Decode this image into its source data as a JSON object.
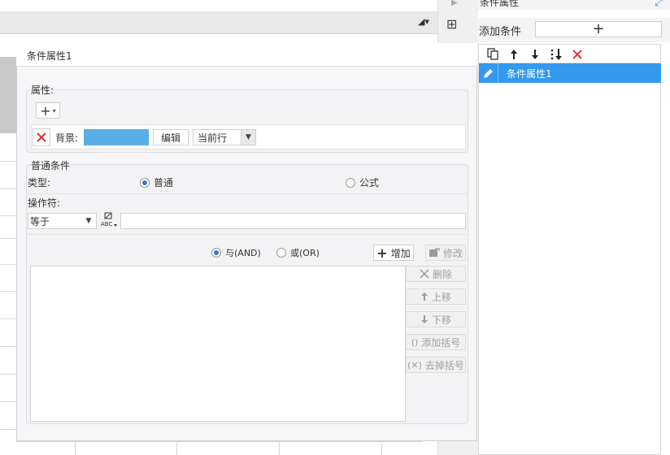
{
  "right_panel": {
    "title": "条件属性",
    "add_condition_label": "添加条件",
    "add_button_glyph": "+",
    "toolbar_icons": [
      "copy-icon",
      "arrow-up-icon",
      "arrow-down-icon",
      "sort-icon",
      "delete-icon"
    ],
    "items": [
      {
        "label": "条件属性1",
        "selected": true
      }
    ],
    "selected_color": "#3399ee"
  },
  "dialog": {
    "title": "条件属性1",
    "attributes": {
      "section_label": "属性:",
      "add_glyph": "+",
      "background_label": "背景:",
      "background_color": "#5aaee8",
      "edit_label": "编辑",
      "scope_value": "当前行"
    },
    "common_conditions": {
      "section_label": "普通条件",
      "type_label": "类型:",
      "type_options": [
        {
          "label": "普通",
          "checked": true
        },
        {
          "label": "公式",
          "checked": false
        }
      ],
      "operator_label": "操作符:",
      "operator_value": "等于",
      "value_input": "",
      "logic_options": [
        {
          "label": "与(AND)",
          "checked": true
        },
        {
          "label": "或(OR)",
          "checked": false
        }
      ],
      "add_button": "增加",
      "modify_button": "修改",
      "delete_button": "删除",
      "move_up_button": "上移",
      "move_down_button": "下移",
      "add_bracket_button": "添加括号",
      "remove_bracket_button": "去掉括号"
    }
  }
}
